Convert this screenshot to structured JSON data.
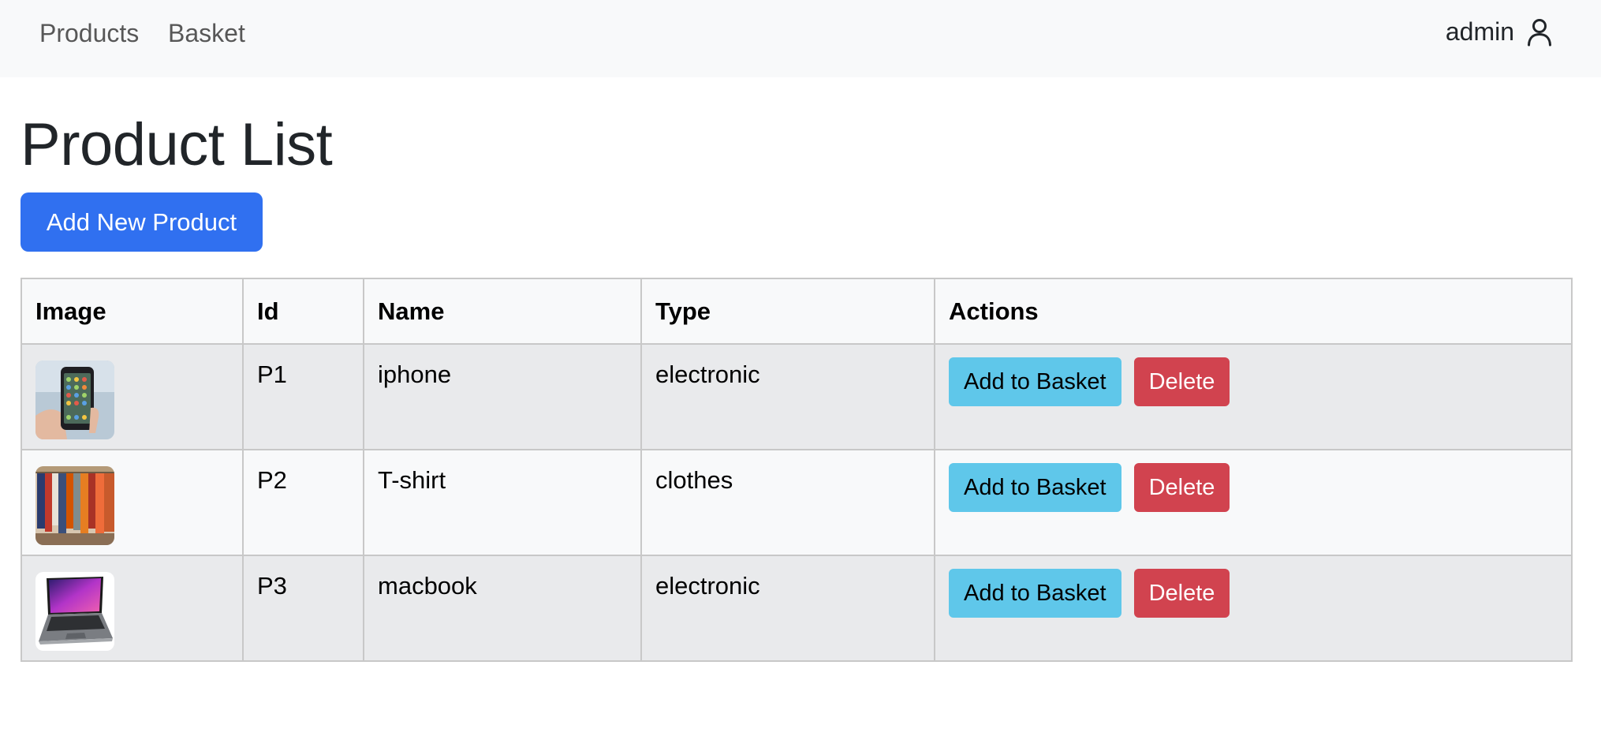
{
  "nav": {
    "products_label": "Products",
    "basket_label": "Basket",
    "user_name": "admin",
    "user_icon": "person-icon"
  },
  "page": {
    "title": "Product List",
    "add_button_label": "Add New Product"
  },
  "table": {
    "headers": [
      "Image",
      "Id",
      "Name",
      "Type",
      "Actions"
    ],
    "rows": [
      {
        "image_icon": "iphone-photo",
        "id": "P1",
        "name": "iphone",
        "type": "electronic",
        "basket_label": "Add to Basket",
        "delete_label": "Delete"
      },
      {
        "image_icon": "tshirt-rack-photo",
        "id": "P2",
        "name": "T-shirt",
        "type": "clothes",
        "basket_label": "Add to Basket",
        "delete_label": "Delete"
      },
      {
        "image_icon": "macbook-photo",
        "id": "P3",
        "name": "macbook",
        "type": "electronic",
        "basket_label": "Add to Basket",
        "delete_label": "Delete"
      }
    ]
  },
  "colors": {
    "primary": "#3070f0",
    "info": "#5fc7ea",
    "danger": "#d1434f",
    "navbar_bg": "#f8f9fa"
  }
}
